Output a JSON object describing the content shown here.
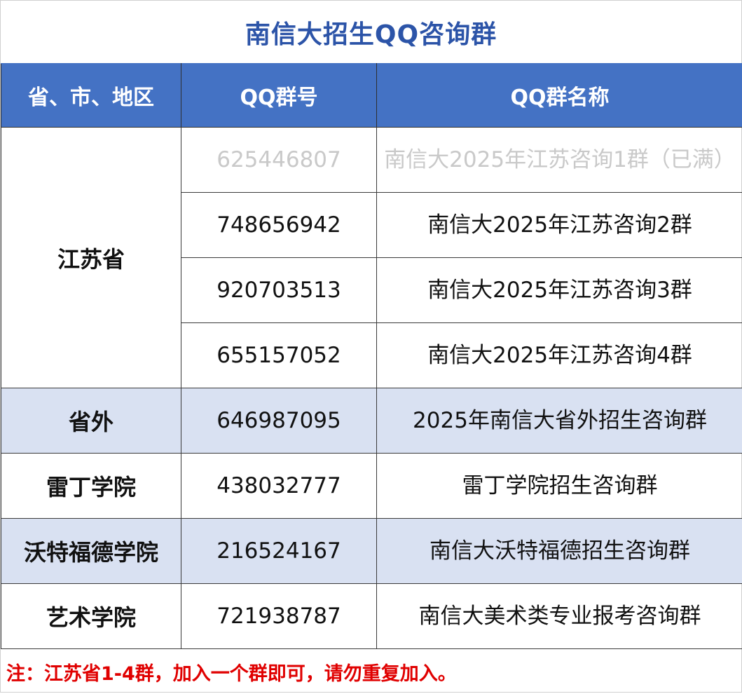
{
  "title": "南信大招生QQ咨询群",
  "headers": [
    "省、市、地区",
    "QQ群号",
    "QQ群名称"
  ],
  "rows": [
    {
      "region": "江苏省",
      "number": "625446807",
      "name": "南信大2025年江苏咨询1群（已满）",
      "status": "full"
    },
    {
      "number": "748656942",
      "name": "南信大2025年江苏咨询2群"
    },
    {
      "number": "920703513",
      "name": "南信大2025年江苏咨询3群"
    },
    {
      "number": "655157052",
      "name": "南信大2025年江苏咨询4群"
    },
    {
      "region": "省外",
      "number": "646987095",
      "name": "2025年南信大省外招生咨询群"
    },
    {
      "region": "雷丁学院",
      "number": "438032777",
      "name": "雷丁学院招生咨询群"
    },
    {
      "region": "沃特福德学院",
      "number": "216524167",
      "name": "南信大沃特福德招生咨询群"
    },
    {
      "region": "艺术学院",
      "number": "721938787",
      "name": "南信大美术类专业报考咨询群"
    }
  ],
  "note": "注：江苏省1-4群，加入一个群即可，请勿重复加入。",
  "colors": {
    "title": "#2c54a8",
    "header_bg": "#4472c4",
    "shade_bg": "#d9e1f2",
    "note": "#e00000",
    "full_text": "#c9c9c9"
  }
}
